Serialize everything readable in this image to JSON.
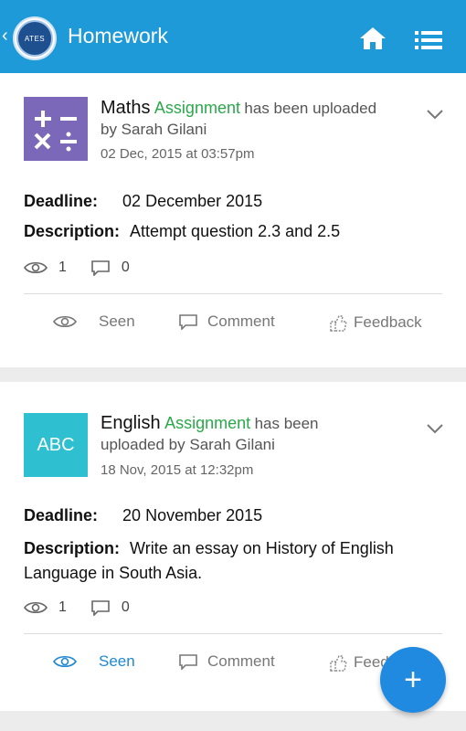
{
  "header": {
    "title": "Homework",
    "back_icon": "chevron-left-icon",
    "logo_text": "ATES"
  },
  "posts": [
    {
      "subject": "Maths",
      "type": "Assignment",
      "uploaded_line1": "has been uploaded",
      "uploaded_line2": "by Sarah Gilani",
      "date": "02 Dec, 2015 at 03:57pm",
      "deadline_label": "Deadline:",
      "deadline": "02 December 2015",
      "description_label": "Description:",
      "description": "Attempt question 2.3 and 2.5",
      "views": "1",
      "comments": "0",
      "actions": {
        "seen": "Seen",
        "comment": "Comment",
        "feedback": "Feedback"
      }
    },
    {
      "subject": "English",
      "type": "Assignment",
      "thumb_text": "ABC",
      "uploaded_line1": "has been",
      "uploaded_line2": "uploaded by Sarah Gilani",
      "date": "18 Nov, 2015 at 12:32pm",
      "deadline_label": "Deadline:",
      "deadline": "20 November 2015",
      "description_label": "Description:",
      "description_line1": "Write an essay on History of English",
      "description_line2": "Language in South Asia.",
      "views": "1",
      "comments": "0",
      "actions": {
        "seen": "Seen",
        "comment": "Comment",
        "feedback": "Feedb"
      }
    }
  ],
  "fab": {
    "label": "+"
  },
  "colors": {
    "appbar": "#1f9ad8",
    "assignment": "#2aa84a",
    "active": "#1f88d0",
    "fab": "#1f8ae0"
  }
}
